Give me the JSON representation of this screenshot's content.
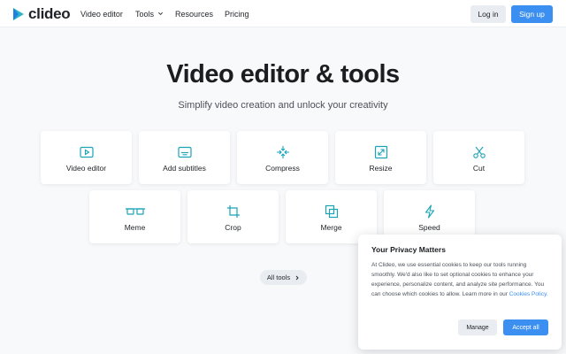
{
  "header": {
    "logo_text": "clideo",
    "nav": [
      "Video editor",
      "Tools",
      "Resources",
      "Pricing"
    ],
    "login_label": "Log in",
    "signup_label": "Sign up"
  },
  "hero": {
    "title": "Video editor & tools",
    "subtitle": "Simplify video creation and unlock your creativity"
  },
  "tools_row1": [
    {
      "label": "Video editor",
      "icon": "play-icon"
    },
    {
      "label": "Add subtitles",
      "icon": "subtitles-icon"
    },
    {
      "label": "Compress",
      "icon": "compress-icon"
    },
    {
      "label": "Resize",
      "icon": "resize-icon"
    },
    {
      "label": "Cut",
      "icon": "scissors-icon"
    }
  ],
  "tools_row2": [
    {
      "label": "Meme",
      "icon": "meme-glasses-icon"
    },
    {
      "label": "Crop",
      "icon": "crop-icon"
    },
    {
      "label": "Merge",
      "icon": "merge-icon"
    },
    {
      "label": "Speed",
      "icon": "lightning-icon"
    }
  ],
  "all_tools_label": "All tools",
  "cookie": {
    "title": "Your Privacy Matters",
    "body": "At Clideo, we use essential cookies to keep our tools running smoothly. We'd also like to set optional cookies to enhance your experience, personalize content, and analyze site performance. You can choose which cookies to allow. Learn more in our",
    "link": "Cookies Policy.",
    "manage_label": "Manage",
    "accept_label": "Accept all"
  },
  "colors": {
    "accent": "#3b8ff0",
    "icon_teal": "#1aa3b5",
    "background": "#f8f9fa"
  }
}
